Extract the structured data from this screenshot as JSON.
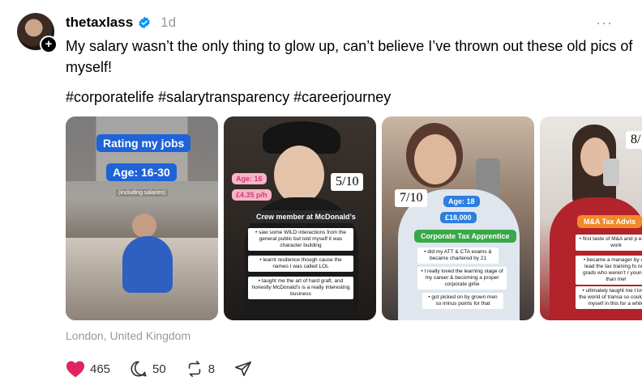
{
  "post": {
    "username": "thetaxlass",
    "time": "1d",
    "more": "···",
    "text": "My salary wasn’t the only thing to glow up, can’t believe I’ve thrown out these old pics of myself!",
    "hashtags": "#corporatelife #salarytransparency #careerjourney",
    "location": "London, United Kingdom"
  },
  "colors": {
    "accent_blue": "#1e63d8",
    "like_red": "#e0245e",
    "verified_blue": "#0095f6"
  },
  "cards": [
    {
      "title": "Rating my jobs",
      "age": "Age: 16-30",
      "note": "(including salaries)"
    },
    {
      "age": "Age: 16",
      "pay": "£4.35 p/h",
      "score": "5/10",
      "role": "Crew member at McDonald’s",
      "bullets": [
        "• saw some WILD interactions from the general public but told myself it was character building",
        "• learnt resilience though cause the names I was called LOL",
        "• taught me the art of hard graft, and honestly McDonald’s is a really interesting business"
      ]
    },
    {
      "score": "7/10",
      "age": "Age: 18",
      "pay": "£18,000",
      "role": "Corporate Tax Apprentice",
      "bullets": [
        "• did my ATT & CTA exams & became chartered by 21",
        "• I really loved the learning stage of my career & becoming a proper corporate girlie",
        "• got picked on by grown men so minus points for that"
      ]
    },
    {
      "score": "8/",
      "role": "M&A Tax Advis",
      "bullets": [
        "• first taste of M&A and p equity work",
        "• became a manager by a & lead the tax training fo new grads who weren’t r younger than me!",
        "• ultimately taught me t loved the world of transa so could see myself in this for a while"
      ]
    }
  ],
  "actions": {
    "likes": "465",
    "comments": "50",
    "reposts": "8"
  },
  "icons": [
    "verified-badge-icon",
    "plus-icon",
    "heart-icon",
    "comment-icon",
    "repost-icon",
    "share-icon"
  ]
}
